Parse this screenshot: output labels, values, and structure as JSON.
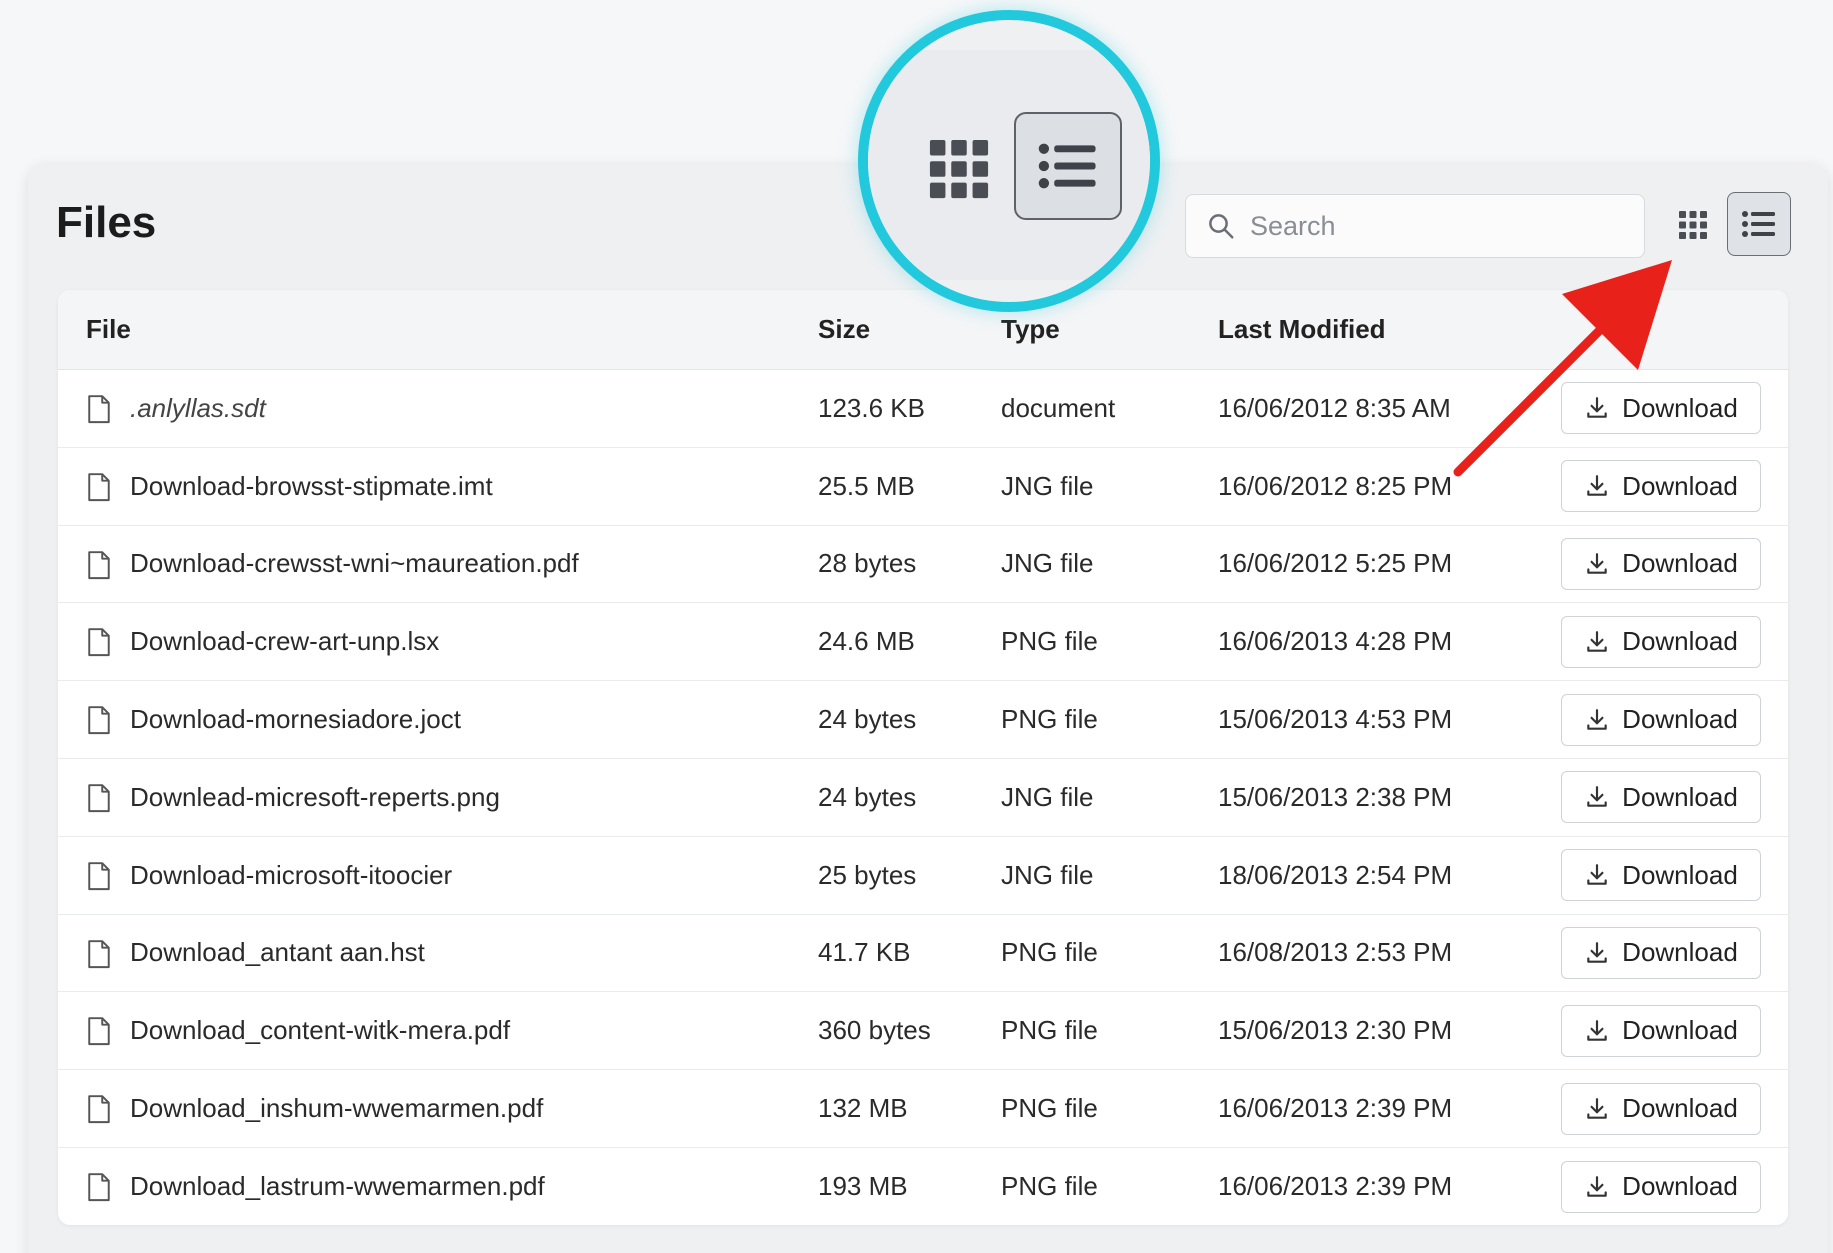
{
  "header": {
    "title": "Files"
  },
  "search": {
    "placeholder": "Search",
    "value": ""
  },
  "view_toggle": {
    "active": "list",
    "grid_icon": "grid-icon",
    "list_icon": "list-icon"
  },
  "table": {
    "columns": {
      "file": "File",
      "size": "Size",
      "type": "Type",
      "modified": "Last Modified"
    },
    "download_label": "Download",
    "rows": [
      {
        "name": ".anlyllas.sdt",
        "size": "123.6 KB",
        "type": "document",
        "modified": "16/06/2012 8:35 AM"
      },
      {
        "name": "Download-browsst-stipmate.imt",
        "size": "25.5 MB",
        "type": "JNG file",
        "modified": "16/06/2012 8:25 PM"
      },
      {
        "name": "Download-crewsst-wni~maureation.pdf",
        "size": "28 bytes",
        "type": "JNG file",
        "modified": "16/06/2012 5:25 PM"
      },
      {
        "name": "Download-crew-art-unp.lsx",
        "size": "24.6 MB",
        "type": "PNG file",
        "modified": "16/06/2013 4:28 PM"
      },
      {
        "name": "Download-mornesiadore.joct",
        "size": "24 bytes",
        "type": "PNG file",
        "modified": "15/06/2013 4:53 PM"
      },
      {
        "name": "Downlead-micresoft-reperts.png",
        "size": "24 bytes",
        "type": "JNG file",
        "modified": "15/06/2013 2:38 PM"
      },
      {
        "name": "Download-microsoft-itoocier",
        "size": "25 bytes",
        "type": "JNG file",
        "modified": "18/06/2013 2:54 PM"
      },
      {
        "name": "Download_antant aan.hst",
        "size": "41.7 KB",
        "type": "PNG file",
        "modified": "16/08/2013 2:53 PM"
      },
      {
        "name": "Download_content-witk-mera.pdf",
        "size": "360 bytes",
        "type": "PNG file",
        "modified": "15/06/2013 2:30 PM"
      },
      {
        "name": "Download_inshum-wwemarmen.pdf",
        "size": "132 MB",
        "type": "PNG file",
        "modified": "16/06/2013 2:39 PM"
      },
      {
        "name": "Download_lastrum-wwemarmen.pdf",
        "size": "193 MB",
        "type": "PNG file",
        "modified": "16/06/2013 2:39 PM"
      }
    ]
  },
  "annotations": {
    "callout_color": "#22c9dc",
    "arrow_color": "#e8221b"
  },
  "colors": {
    "panel_bg": "#eef0f2",
    "table_bg": "#ffffff",
    "header_bg": "#f4f5f7",
    "border": "#cfd2d7"
  }
}
